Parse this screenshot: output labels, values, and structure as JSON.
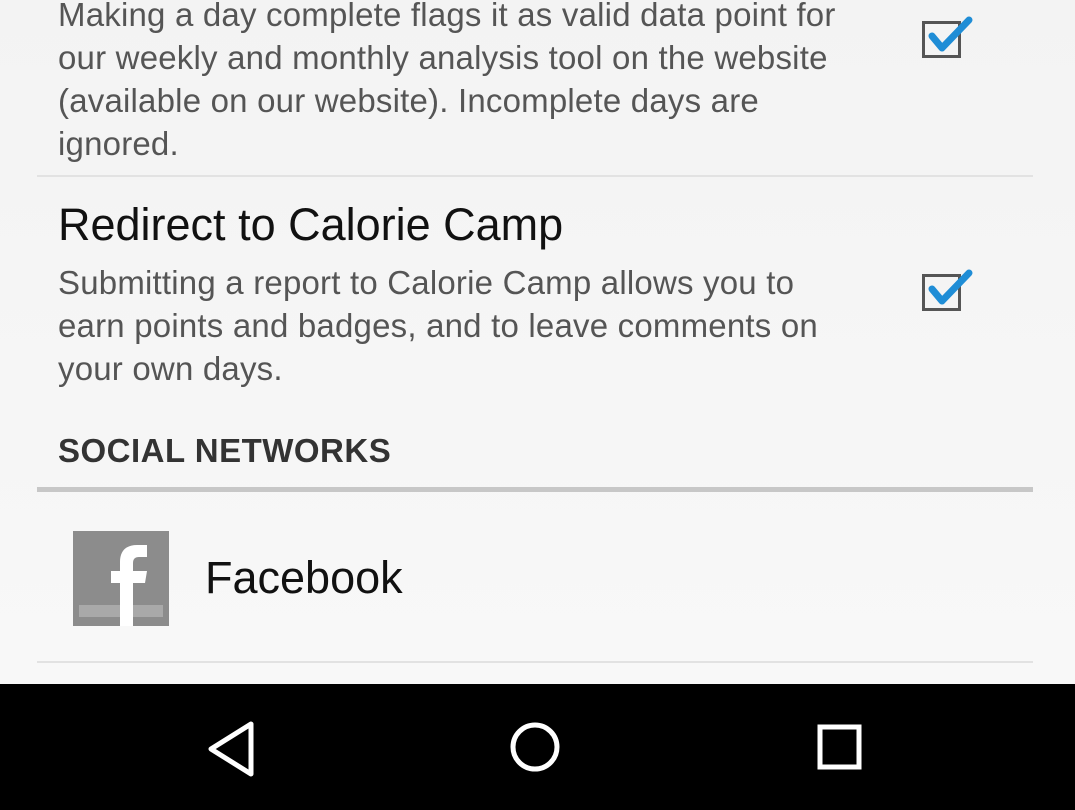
{
  "preferences": [
    {
      "title": "",
      "summary": "Making a day complete flags it as valid data point for our weekly and monthly analysis tool on the website (available on our website). Incomplete days are ignored.",
      "checked": true
    },
    {
      "title": "Redirect to Calorie Camp",
      "summary": "Submitting a report to Calorie Camp allows you to earn points and badges, and to leave comments on your own days.",
      "checked": true
    }
  ],
  "social_section": {
    "header": "SOCIAL NETWORKS",
    "items": [
      {
        "label": "Facebook",
        "icon": "facebook-icon"
      }
    ]
  },
  "navigation_bar": {
    "buttons": [
      {
        "name": "back",
        "icon": "triangle-back-icon"
      },
      {
        "name": "home",
        "icon": "circle-home-icon"
      },
      {
        "name": "recents",
        "icon": "square-recents-icon"
      }
    ]
  },
  "colors": {
    "check_accent": "#1f8dd6",
    "navbar_background": "#000000",
    "page_background": "#f5f5f5"
  }
}
